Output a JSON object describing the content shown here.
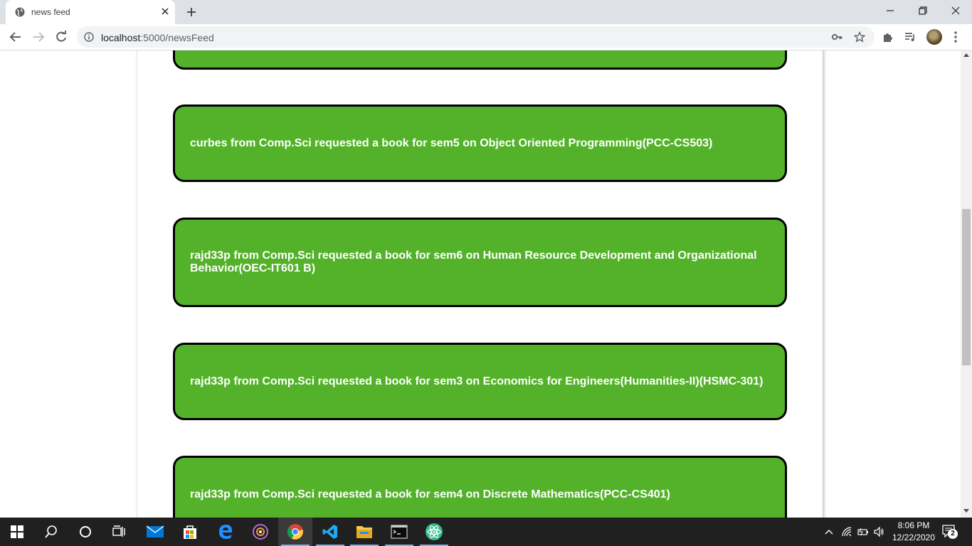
{
  "browser": {
    "tab_title": "news feed",
    "url_host": "localhost",
    "url_rest": ":5000/newsFeed"
  },
  "feed": {
    "items": [
      "curbes from Comp.Sci requested a book for sem5 on Object Oriented Programming(PCC-CS503)",
      "rajd33p from Comp.Sci requested a book for sem6 on Human Resource Development and Organizational Behavior(OEC-IT601 B)",
      "rajd33p from Comp.Sci requested a book for sem3 on Economics for Engineers(Humanities-II)(HSMC-301)",
      "rajd33p from Comp.Sci requested a book for sem4 on Discrete Mathematics(PCC-CS401)"
    ]
  },
  "taskbar": {
    "time": "8:06 PM",
    "date": "12/22/2020",
    "notification_count": "2"
  },
  "colors": {
    "card_green": "#54b22a",
    "card_border": "#000000",
    "taskbar": "#202020"
  }
}
